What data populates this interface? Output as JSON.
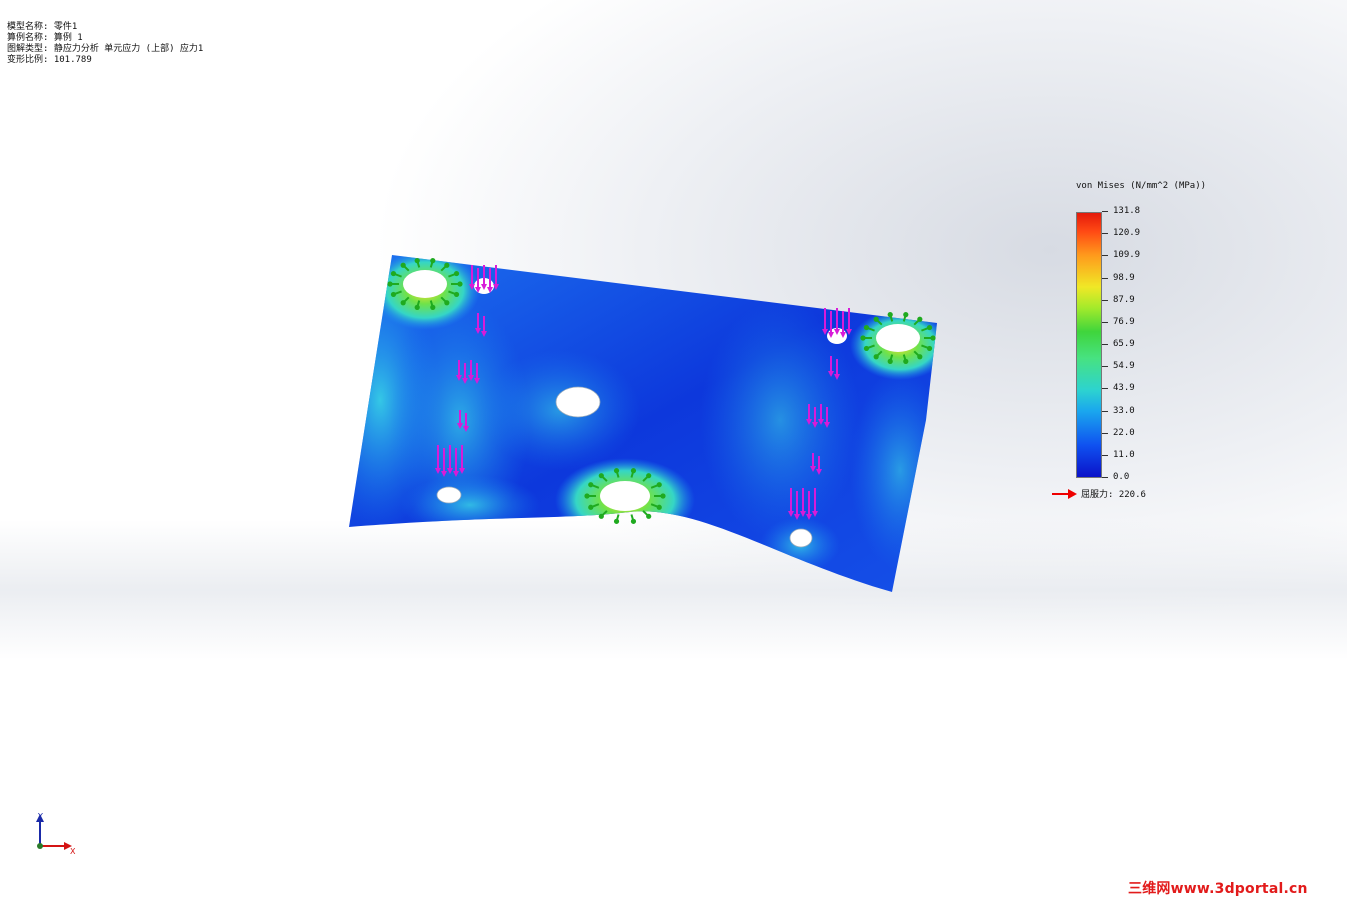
{
  "info": {
    "model_name": "模型名称: 零件1",
    "study_name": "算例名称: 算例 1",
    "plot_type": "图解类型: 静应力分析 单元应力 (上部) 应力1",
    "deform_scale": "变形比例: 101.789"
  },
  "legend": {
    "title": "von Mises (N/mm^2 (MPa))",
    "ticks": [
      "131.8",
      "120.9",
      "109.9",
      "98.9",
      "87.9",
      "76.9",
      "65.9",
      "54.9",
      "43.9",
      "33.0",
      "22.0",
      "11.0",
      "0.0"
    ],
    "yield_label": "屈服力: 220.6"
  },
  "triad": {
    "y_label": "Y",
    "x_label": "X"
  },
  "watermark": "三维网www.3dportal.cn",
  "colors": {
    "min": "#0b12c9",
    "max": "#e41a0b",
    "fixture": "#1faa1f",
    "load": "#d81bd8"
  },
  "icons": [
    "fixture-arrow-icon",
    "load-arrow-icon",
    "coordinate-triad-icon",
    "yield-arrow-icon"
  ]
}
